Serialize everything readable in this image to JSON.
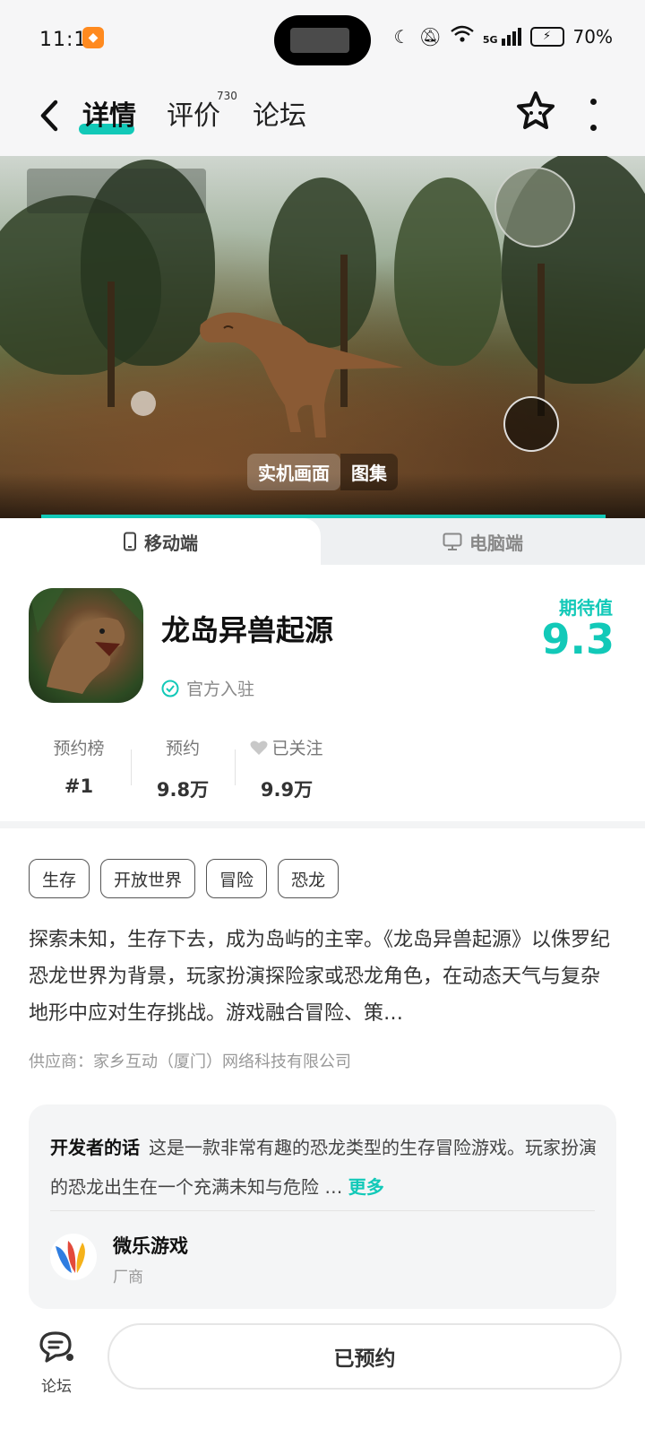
{
  "status_bar": {
    "time": "11:16",
    "network": "5G",
    "battery_percent": "70%"
  },
  "nav": {
    "tabs": [
      {
        "label": "详情"
      },
      {
        "label": "评价"
      },
      {
        "label": "论坛"
      }
    ],
    "review_count": "730"
  },
  "media": {
    "tags": [
      "实机画面",
      "图集"
    ]
  },
  "platform": {
    "mobile_label": "移动端",
    "pc_label": "电脑端"
  },
  "app": {
    "title": "龙岛异兽起源",
    "verified_label": "官方入驻",
    "rating_label": "期待值",
    "rating_value": "9.3"
  },
  "stats": [
    {
      "label": "预约榜",
      "value": "#1"
    },
    {
      "label": "预约",
      "value": "9.8万"
    },
    {
      "label": "已关注",
      "value": "9.9万"
    }
  ],
  "tags": [
    "生存",
    "开放世界",
    "冒险",
    "恐龙"
  ],
  "description": "探索未知，生存下去，成为岛屿的主宰。《龙岛异兽起源》以侏罗纪恐龙世界为背景，玩家扮演探险家或恐龙角色，在动态天气与复杂地形中应对生存挑战。游戏融合冒险、策…",
  "vendor": "供应商：家乡互动（厦门）网络科技有限公司",
  "developer": {
    "heading": "开发者的话",
    "text": "这是一款非常有趣的恐龙类型的生存冒险游戏。玩家扮演的恐龙出生在一个充满未知与危险 …",
    "more_label": "更多",
    "name": "微乐游戏",
    "role": "厂商"
  },
  "bottom": {
    "forum_label": "论坛",
    "reserve_label": "已预约"
  },
  "colors": {
    "accent": "#12c9b8"
  }
}
